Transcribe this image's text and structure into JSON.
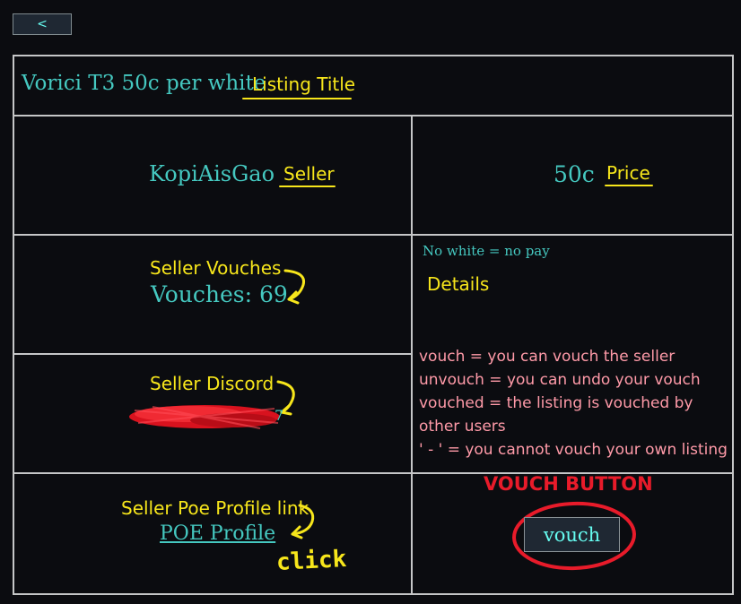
{
  "nav": {
    "back_label": "<"
  },
  "listing": {
    "title": "Vorici T3 50c per white",
    "seller": "KopiAisGao",
    "price": "50c",
    "vouches_text": "Vouches: 69",
    "details": "No white = no pay",
    "poe_profile_link": "POE Profile",
    "vouch_button_label": "vouch"
  },
  "annotations": {
    "listing_title": "Listing Title",
    "seller": "Seller",
    "price": "Price",
    "seller_vouches": "Seller Vouches",
    "details": "Details",
    "seller_discord": "Seller Discord",
    "seller_poe_profile": "Seller Poe Profile link",
    "click": "click",
    "vouch_button": "VOUCH BUTTON",
    "help_lines": [
      "vouch = you can vouch the seller",
      "unvouch = you can undo your vouch",
      "vouched = the listing is vouched by",
      "other users",
      "' - ' = you cannot vouch your own listing"
    ]
  },
  "colors": {
    "background": "#0b0c10",
    "teal_text": "#45c8c0",
    "annotation_yellow": "#f7e61b",
    "annotation_red": "#e81b2a",
    "help_text_pink": "#ff9aa8"
  }
}
